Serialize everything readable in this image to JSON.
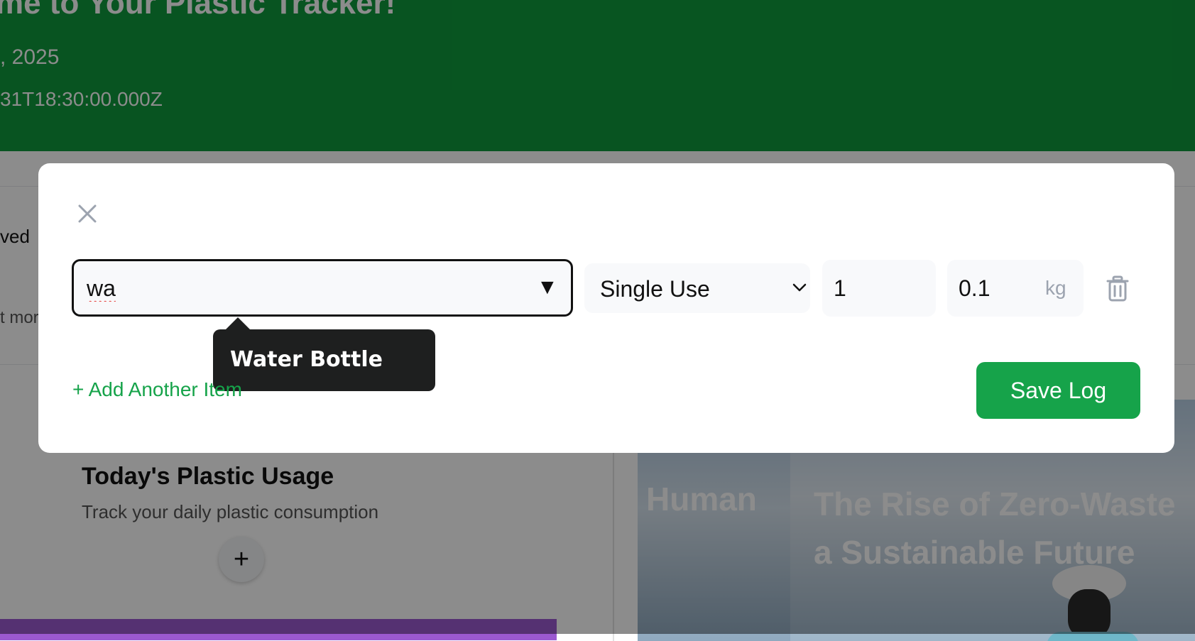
{
  "hero": {
    "title": "me to Your Plastic Tracker!",
    "date": ", 2025",
    "timestamp": "31T18:30:00.000Z",
    "color": "#0f9a3c"
  },
  "stats": {
    "saved_text": "ved",
    "more_text": "t mor"
  },
  "usage": {
    "title": "Today's Plastic Usage",
    "subtitle": "Track your daily plastic consumption",
    "add_symbol": "+"
  },
  "articles": [
    {
      "title": "Human"
    },
    {
      "title_line1": "The Rise of Zero-Waste",
      "title_line2": "a Sustainable Future"
    }
  ],
  "modal": {
    "item": {
      "value": "wa",
      "dropdown_symbol": "▼",
      "suggestion": "Water Bottle"
    },
    "type": {
      "selected": "Single Use"
    },
    "quantity": {
      "value": "1"
    },
    "weight": {
      "value": "0.1",
      "unit": "kg"
    },
    "add_another_label": "+ Add Another Item",
    "save_label": "Save Log",
    "accent_color": "#16a34a"
  }
}
